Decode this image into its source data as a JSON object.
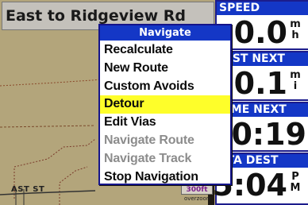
{
  "map": {
    "road_banner": "East to Ridgeview Rd",
    "street_label": "AST ST",
    "scale_label": "300",
    "scale_unit_suffix": "ft",
    "overzoom_label": "overzoom"
  },
  "menu": {
    "title": "Navigate",
    "items": [
      {
        "label": "Recalculate",
        "state": "enabled"
      },
      {
        "label": "New Route",
        "state": "enabled"
      },
      {
        "label": "Custom Avoids",
        "state": "enabled"
      },
      {
        "label": "Detour",
        "state": "selected"
      },
      {
        "label": "Edit Vias",
        "state": "enabled"
      },
      {
        "label": "Navigate Route",
        "state": "disabled"
      },
      {
        "label": "Navigate Track",
        "state": "disabled"
      },
      {
        "label": "Stop Navigation",
        "state": "enabled"
      }
    ]
  },
  "fields": [
    {
      "label": "SPEED",
      "value": "0.0",
      "unit_top": "m",
      "unit_bottom": "h"
    },
    {
      "label": "DIST NEXT",
      "value": "0.1",
      "unit_top": "m",
      "unit_bottom": "i"
    },
    {
      "label": "TIME NEXT",
      "value": "00:19",
      "unit_top": "",
      "unit_bottom": ""
    },
    {
      "label": "ETA DEST",
      "value": "5:04",
      "unit_top": "P",
      "unit_bottom": "M"
    }
  ],
  "colors": {
    "map_background": "#b3a57b",
    "title_bar": "#1437c6",
    "selected_highlight": "#fefe2a",
    "disabled_text": "#8c8c8c"
  }
}
